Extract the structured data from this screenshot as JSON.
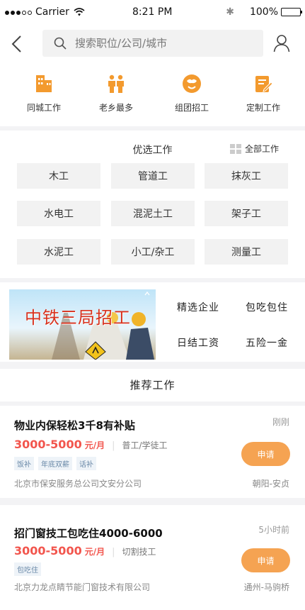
{
  "status_bar": {
    "carrier": "Carrier",
    "time": "8:21 PM",
    "battery": "100%"
  },
  "search": {
    "placeholder": "搜索职位/公司/城市"
  },
  "quick_links": [
    {
      "label": "同城工作",
      "icon": "building-icon"
    },
    {
      "label": "老乡最多",
      "icon": "people-icon"
    },
    {
      "label": "组团招工",
      "icon": "globe-icon"
    },
    {
      "label": "定制工作",
      "icon": "edit-document-icon"
    }
  ],
  "featured": {
    "title": "优选工作",
    "all_label": "全部工作",
    "categories": [
      "木工",
      "管道工",
      "抹灰工",
      "水电工",
      "混泥土工",
      "架子工",
      "水泥工",
      "小工/杂工",
      "测量工"
    ]
  },
  "promo": {
    "banner_text": "中铁三局招工",
    "tags": [
      "精选企业",
      "包吃包住",
      "日结工资",
      "五险一金"
    ]
  },
  "recommended": {
    "title": "推荐工作",
    "jobs": [
      {
        "title": "物业内保轻松3千8有补贴",
        "time": "刚刚",
        "salary": "3000-5000",
        "unit": "元/月",
        "type": "普工/学徒工",
        "tags": [
          "饭补",
          "年底双薪",
          "话补"
        ],
        "company": "北京市保安服务总公司文安分公司",
        "location": "朝阳-安贞",
        "apply_label": "申请"
      },
      {
        "title": "招门窗技工包吃住4000-6000",
        "time": "5小时前",
        "salary": "3000-5000",
        "unit": "元/月",
        "type": "切割技工",
        "tags": [
          "包吃住"
        ],
        "company": "北京力龙点睛节能门窗技术有限公司",
        "location": "通州-马驹桥",
        "apply_label": "申请"
      }
    ]
  },
  "colors": {
    "accent": "#f5a352",
    "salary": "#f2554d",
    "tag_text": "#6a89a8"
  }
}
